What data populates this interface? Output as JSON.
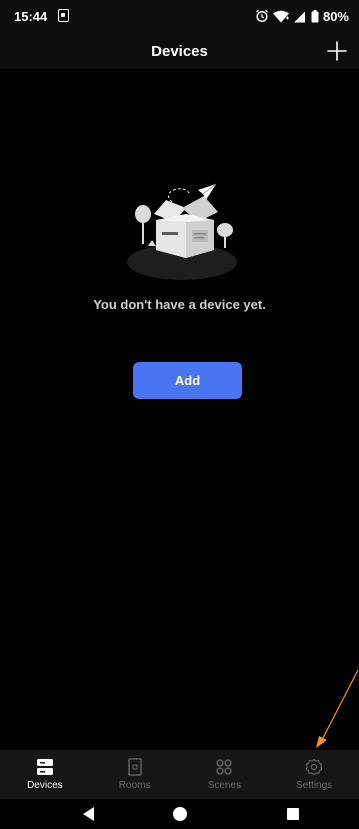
{
  "status_bar": {
    "time": "15:44",
    "battery": "80%"
  },
  "header": {
    "title": "Devices",
    "add_icon": "plus-icon"
  },
  "empty_state": {
    "message": "You don't have a device yet.",
    "add_label": "Add",
    "illustration": "empty-box-illustration"
  },
  "nav": {
    "items": [
      {
        "label": "Devices",
        "icon": "devices-icon",
        "active": true
      },
      {
        "label": "Rooms",
        "icon": "door-icon",
        "active": false
      },
      {
        "label": "Scenes",
        "icon": "scenes-icon",
        "active": false
      },
      {
        "label": "Settings",
        "icon": "gear-icon",
        "active": false
      }
    ]
  },
  "system_nav": {
    "back_icon": "back-triangle-icon",
    "home_icon": "home-circle-icon",
    "recents_icon": "recents-square-icon"
  },
  "colors": {
    "accent": "#4a75f0",
    "background": "#000000",
    "bar": "#0d0d0d",
    "nav_bar": "#161616",
    "annotation": "#f7931e"
  }
}
